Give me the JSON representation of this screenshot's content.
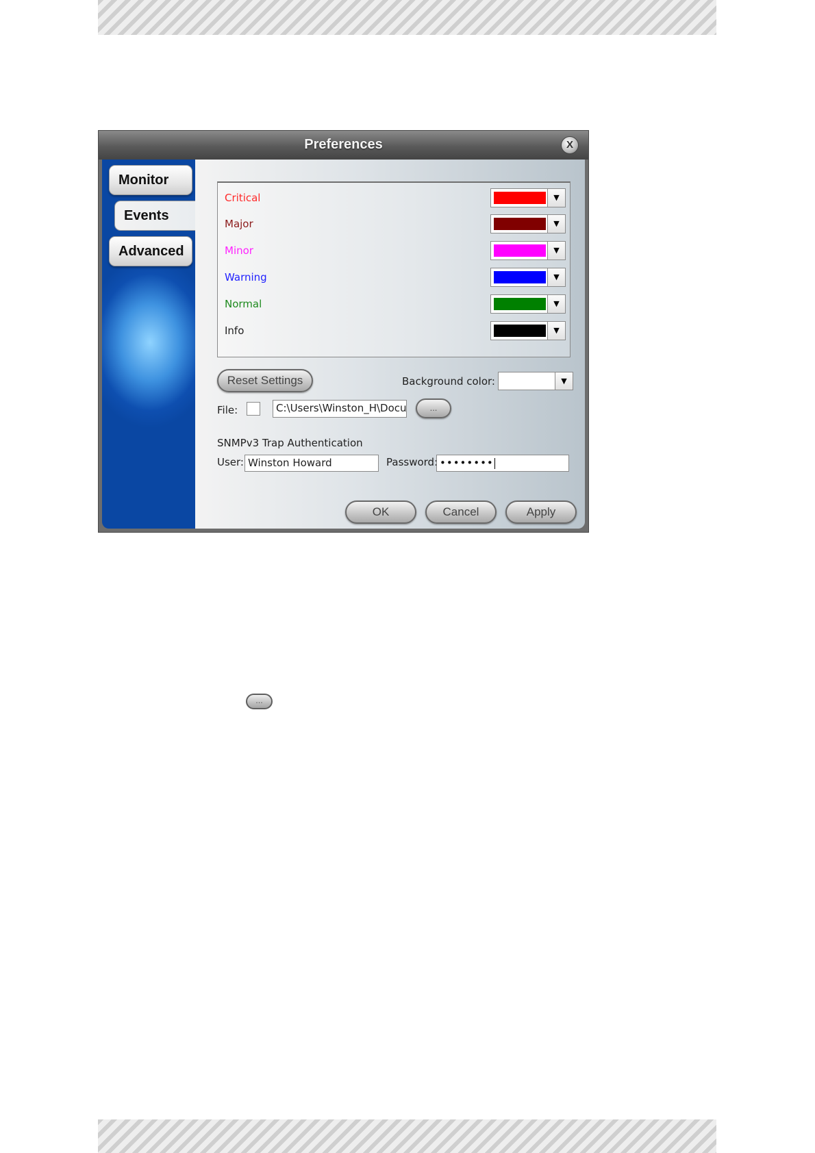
{
  "window": {
    "title": "Preferences",
    "close_label": "X"
  },
  "tabs": [
    {
      "label": "Monitor",
      "selected": false
    },
    {
      "label": "Events",
      "selected": true
    },
    {
      "label": "Advanced",
      "selected": false
    }
  ],
  "severities": [
    {
      "label": "Critical",
      "label_color": "#ff2a2a",
      "swatch_color": "#ff0000"
    },
    {
      "label": "Major",
      "label_color": "#8b1a1a",
      "swatch_color": "#800000"
    },
    {
      "label": "Minor",
      "label_color": "#ff22ff",
      "swatch_color": "#ff00ff"
    },
    {
      "label": "Warning",
      "label_color": "#2222ff",
      "swatch_color": "#0000ff"
    },
    {
      "label": "Normal",
      "label_color": "#1e8a1e",
      "swatch_color": "#008000"
    },
    {
      "label": "Info",
      "label_color": "#222222",
      "swatch_color": "#000000"
    }
  ],
  "reset_label": "Reset Settings",
  "background": {
    "label": "Background color:",
    "value": "#ffffff"
  },
  "file": {
    "label": "File:",
    "checked": false,
    "path": "C:\\Users\\Winston_H\\Documents",
    "browse_label": "..."
  },
  "snmp": {
    "title": "SNMPv3 Trap Authentication",
    "user_label": "User:",
    "user_value": "Winston Howard",
    "password_label": "Password:",
    "password_masked": "••••••••"
  },
  "buttons": {
    "ok": "OK",
    "cancel": "Cancel",
    "apply": "Apply"
  },
  "inline_browse_label": "..."
}
